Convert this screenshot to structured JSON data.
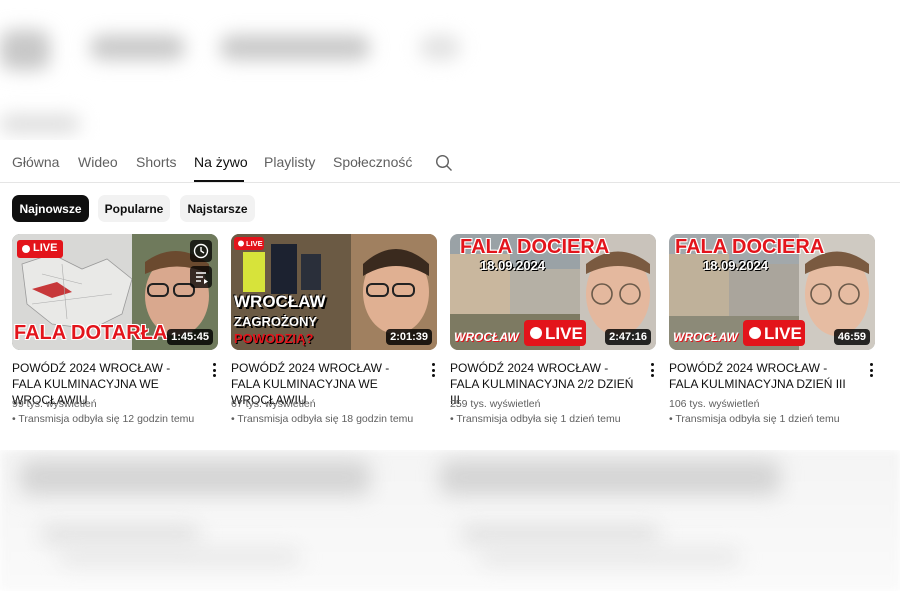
{
  "tabs": [
    "Główna",
    "Wideo",
    "Shorts",
    "Na żywo",
    "Playlisty",
    "Społeczność"
  ],
  "active_tab": "Na żywo",
  "chips": [
    "Najnowsze",
    "Popularne",
    "Najstarsze"
  ],
  "active_chip": "Najnowsze",
  "videos": [
    {
      "title": "POWÓDŹ 2024 WROCŁAW - FALA KULMINACYJNA WE WROCŁAWIU",
      "views": "99 tys. wyświetleń",
      "streamed": "• Transmisja odbyła się 12 godzin temu",
      "duration": "1:45:45",
      "thumb_text": "FALA DOTARŁA",
      "thumb_live": "LIVE"
    },
    {
      "title": "POWÓDŹ 2024 WROCŁAW - FALA KULMINACYJNA WE WROCŁAWIU",
      "views": "67 tys. wyświetleń",
      "streamed": "• Transmisja odbyła się 18 godzin temu",
      "duration": "2:01:39",
      "thumb_text_1": "WROCŁAW",
      "thumb_text_2": "ZAGROŻONY",
      "thumb_text_3": "POWODZIĄ?",
      "thumb_live": "LIVE"
    },
    {
      "title": "POWÓDŹ 2024 WROCŁAW - FALA KULMINACYJNA 2/2 DZIEŃ III",
      "views": "259 tys. wyświetleń",
      "streamed": "• Transmisja odbyła się 1 dzień temu",
      "duration": "2:47:16",
      "thumb_text_1": "FALA DOCIERA",
      "thumb_date": "18.09.2024",
      "thumb_text_2": "WROCŁAW",
      "thumb_live": "LIVE"
    },
    {
      "title": "POWÓDŹ 2024 WROCŁAW - FALA KULMINACYJNA DZIEŃ III",
      "views": "106 tys. wyświetleń",
      "streamed": "• Transmisja odbyła się 1 dzień temu",
      "duration": "46:59",
      "thumb_text_1": "FALA DOCIERA",
      "thumb_date": "18.09.2024",
      "thumb_text_2": "WROCŁAW",
      "thumb_live": "LIVE"
    }
  ],
  "icons": [
    "search-icon",
    "more-vert-icon",
    "watch-later-icon",
    "add-to-queue-icon",
    "live-dot-icon"
  ],
  "colors": {
    "live_red": "#ff0000",
    "thumb_red": "#e3141b",
    "text": "#0f0f0f",
    "secondary": "#606060"
  }
}
